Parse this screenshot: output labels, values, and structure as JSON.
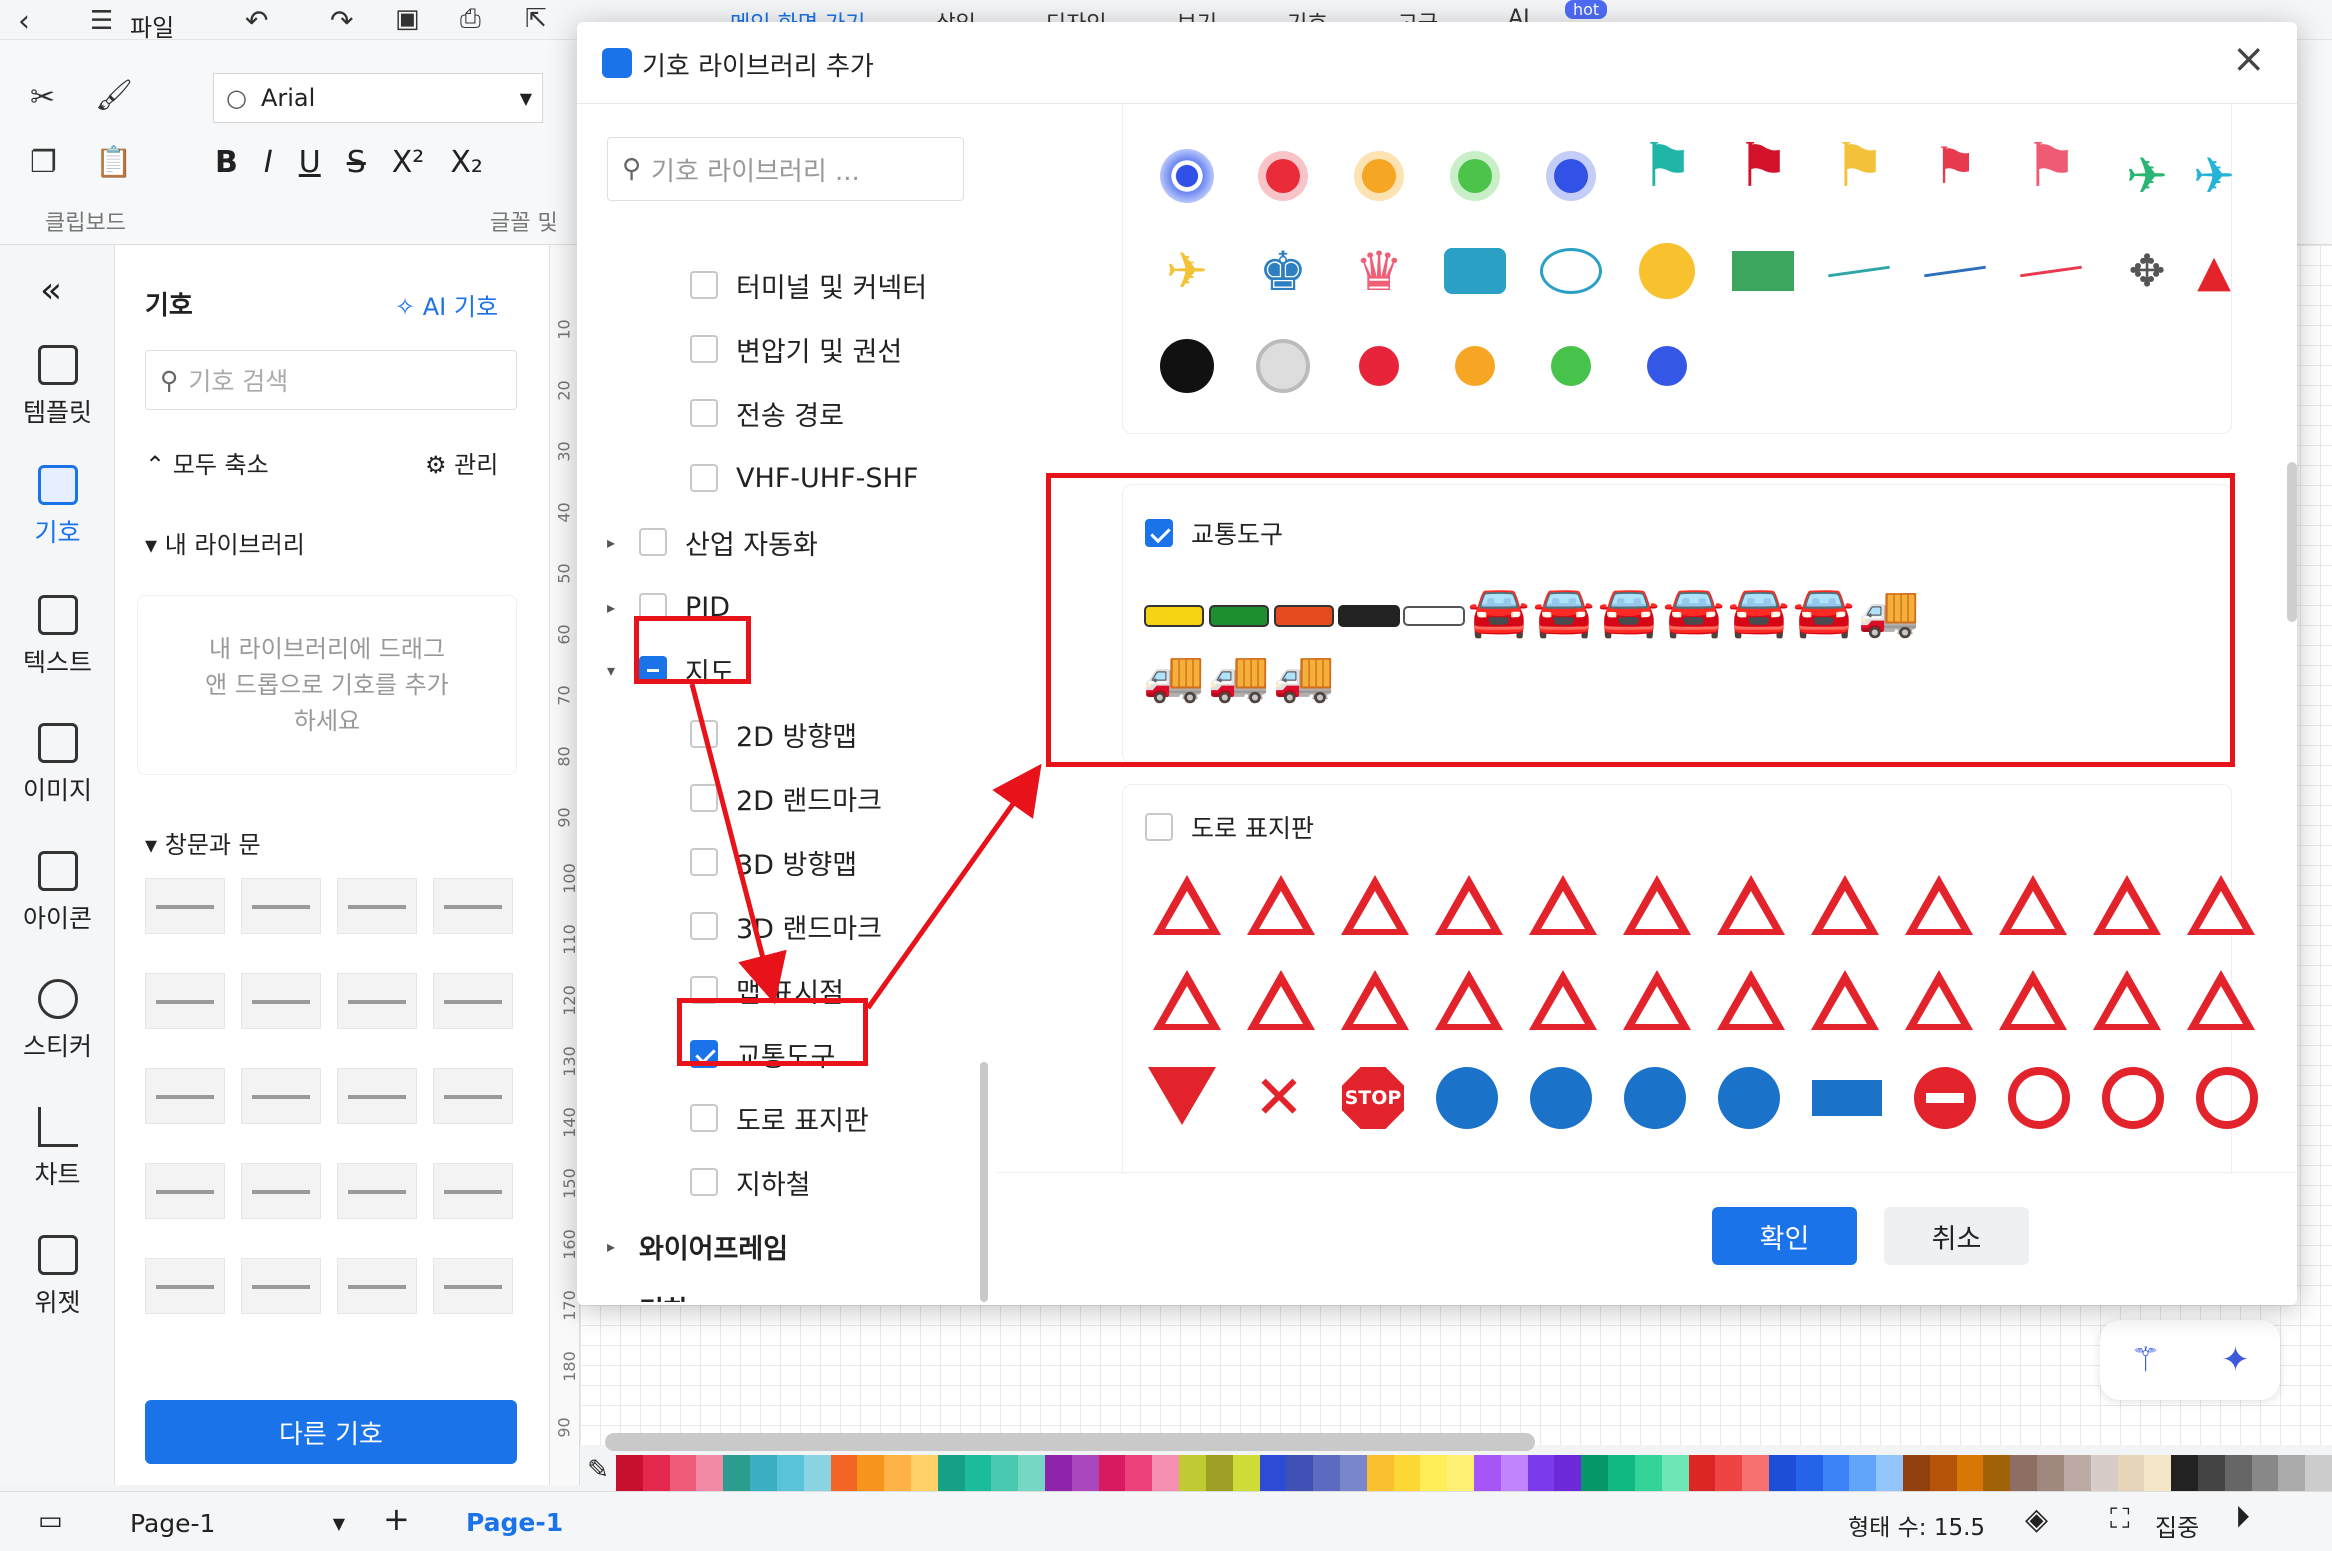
{
  "topbar": {
    "file_label": "파일",
    "menu": [
      "메인 화면 가기",
      "삽입",
      "디자인",
      "보기",
      "기호",
      "고급",
      "AI"
    ],
    "hot_badge": "hot"
  },
  "ribbon": {
    "font_name": "Arial",
    "clipboard_label": "클립보드",
    "font_group_label": "글꼴 및"
  },
  "leftnav": {
    "items": [
      "템플릿",
      "기호",
      "텍스트",
      "이미지",
      "아이콘",
      "스티커",
      "차트",
      "위젯"
    ]
  },
  "sympanel": {
    "title": "기호",
    "ai_label": "AI 기호",
    "search_placeholder": "기호 검색",
    "collapse_all": "모두 축소",
    "manage": "관리",
    "my_library": "내 라이브러리",
    "drop_hint": "내 라이브러리에 드래그 앤 드롭으로 기호를 추가하세요",
    "section": "창문과 문",
    "more_button": "다른 기호"
  },
  "ruler": [
    "10",
    "20",
    "30",
    "40",
    "50",
    "60",
    "70",
    "80",
    "90",
    "100",
    "110",
    "120",
    "130",
    "140",
    "150",
    "160",
    "170",
    "180",
    "90"
  ],
  "dialog": {
    "title": "기호 라이브러리 추가",
    "search_placeholder": "기호 라이브러리 ...",
    "tree": [
      {
        "label": "터미널 및 커넥터",
        "state": "off"
      },
      {
        "label": "변압기 및 권선",
        "state": "off"
      },
      {
        "label": "전송 경로",
        "state": "off"
      },
      {
        "label": "VHF-UHF-SHF",
        "state": "off"
      },
      {
        "label": "산업 자동화",
        "state": "off"
      },
      {
        "label": "PID",
        "state": "off"
      },
      {
        "label": "지도",
        "state": "partial"
      },
      {
        "label": "2D 방향맵",
        "state": "off"
      },
      {
        "label": "2D 랜드마크",
        "state": "off"
      },
      {
        "label": "3D 방향맵",
        "state": "off"
      },
      {
        "label": "3D 랜드마크",
        "state": "off"
      },
      {
        "label": "맵 표시점",
        "state": "off"
      },
      {
        "label": "교통도구",
        "state": "on"
      },
      {
        "label": "도로 표지판",
        "state": "off"
      },
      {
        "label": "지하철",
        "state": "off"
      },
      {
        "label": "와이어프레임",
        "state": "off"
      },
      {
        "label": "기하",
        "state": "off"
      }
    ],
    "group_vehicles": "교통도구",
    "group_signs": "도로 표지판",
    "confirm": "확인",
    "cancel": "취소"
  },
  "bottombar": {
    "page_select": "Page-1",
    "page_tab": "Page-1",
    "shape_count": "형태 수: 15.5",
    "focus": "집중"
  },
  "colors": {
    "accent": "#1a73e8",
    "highlight": "#e8121a",
    "palette": [
      "#c8102e",
      "#e4284d",
      "#ef5b7b",
      "#f28aa6",
      "#2a9d8f",
      "#3aafc3",
      "#59c3d9",
      "#8ad3e3",
      "#f26522",
      "#f7941d",
      "#ffb347",
      "#ffd166",
      "#16a085",
      "#1abc9c",
      "#48c9b0",
      "#76d7c4",
      "#8e24aa",
      "#ab47bc",
      "#d81b60",
      "#ec407a",
      "#f48fb1",
      "#c0ca33",
      "#9e9d24",
      "#cddc39",
      "#2e4bd6",
      "#3f51b5",
      "#5c6bc0",
      "#7986cb",
      "#fbc02d",
      "#fdd835",
      "#ffee58",
      "#fff176",
      "#a855f7",
      "#c084fc",
      "#7c3aed",
      "#6d28d9",
      "#059669",
      "#10b981",
      "#34d399",
      "#6ee7b7",
      "#dc2626",
      "#ef4444",
      "#f87171",
      "#1d4ed8",
      "#2563eb",
      "#3b82f6",
      "#60a5fa",
      "#93c5fd",
      "#92400e",
      "#b45309",
      "#d97706",
      "#a16207",
      "#8d6e63",
      "#a1887f",
      "#bcaaa4",
      "#d7ccc8",
      "#e6d5b8",
      "#f5e6c8",
      "#222222",
      "#444444",
      "#666666",
      "#888888",
      "#aaaaaa",
      "#cccccc"
    ]
  }
}
